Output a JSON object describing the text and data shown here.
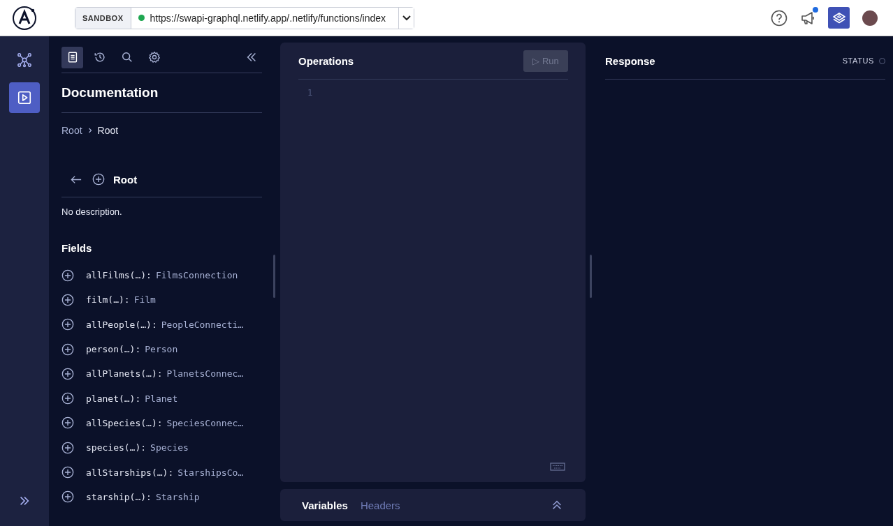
{
  "header": {
    "env_label": "SANDBOX",
    "url": "https://swapi-graphql.netlify.app/.netlify/functions/index",
    "connected": true,
    "notification": true
  },
  "rail": {
    "items": [
      {
        "kind": "graph",
        "selected": false
      },
      {
        "kind": "play",
        "selected": true
      }
    ]
  },
  "docs": {
    "tabs": [
      {
        "kind": "docs",
        "selected": true
      },
      {
        "kind": "history",
        "selected": false
      },
      {
        "kind": "search",
        "selected": false
      },
      {
        "kind": "settings",
        "selected": false
      }
    ],
    "title": "Documentation",
    "breadcrumb": [
      "Root",
      "Root"
    ],
    "type_name": "Root",
    "description": "No description.",
    "fields_heading": "Fields",
    "fields": [
      {
        "name": "allFilms(…):",
        "type": "FilmsConnection"
      },
      {
        "name": "film(…):",
        "type": "Film"
      },
      {
        "name": "allPeople(…):",
        "type": "PeopleConnecti…"
      },
      {
        "name": "person(…):",
        "type": "Person"
      },
      {
        "name": "allPlanets(…):",
        "type": "PlanetsConnec…"
      },
      {
        "name": "planet(…):",
        "type": "Planet"
      },
      {
        "name": "allSpecies(…):",
        "type": "SpeciesConnec…"
      },
      {
        "name": "species(…):",
        "type": "Species"
      },
      {
        "name": "allStarships(…):",
        "type": "StarshipsCo…"
      },
      {
        "name": "starship(…):",
        "type": "Starship"
      }
    ]
  },
  "operations": {
    "title": "Operations",
    "run_label": "▷ Run",
    "run_disabled": true,
    "line_numbers": [
      "1"
    ]
  },
  "bottom_tabs": [
    {
      "label": "Variables",
      "selected": true
    },
    {
      "label": "Headers",
      "selected": false
    }
  ],
  "response": {
    "title": "Response",
    "status_label": "STATUS"
  }
}
